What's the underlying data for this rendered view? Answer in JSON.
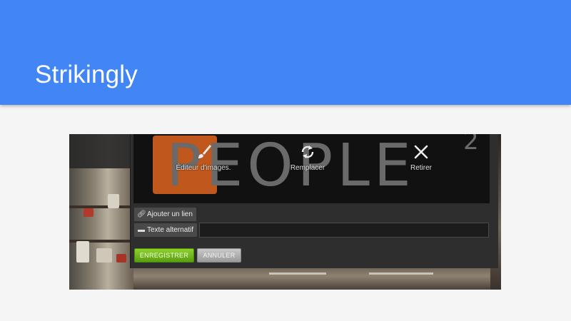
{
  "slide": {
    "title": "Strikingly"
  },
  "editor": {
    "logo_text": "PEOPLE",
    "logo_superscript": "2",
    "tools": [
      {
        "label": "Éditeur d'images.",
        "icon": "paintbrush-icon"
      },
      {
        "label": "Remplacer",
        "icon": "refresh-icon"
      },
      {
        "label": "Retirer",
        "icon": "close-icon"
      }
    ],
    "add_link_label": "Ajouter un lien",
    "alt_text_label": "Texte alternatif",
    "alt_text_value": "",
    "save_label": "ENREGISTRER",
    "cancel_label": "ANNULER"
  },
  "colors": {
    "header": "#4285f4",
    "save_button": "#6fb81c",
    "logo_accent": "#c0571c"
  }
}
